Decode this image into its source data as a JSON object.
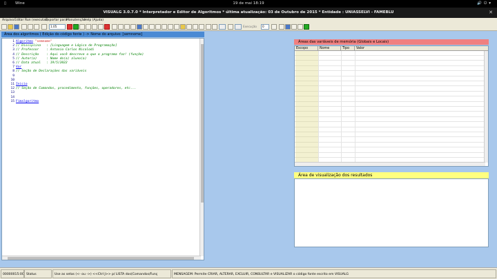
{
  "topbar": {
    "activities": "▯",
    "app_name": "Wine",
    "clock": "19 de mai   18:19",
    "tray": "🔊⏻▾"
  },
  "window": {
    "title": "VISUALG 3.0.7.0 * Interpretador e Editor de Algoritmos * última atualização: 03 de Outubro de 2015 * Entidade : UNIASSELVI - FAMEBLU",
    "close": "✕"
  },
  "menu": [
    "Arquivo",
    "Editar",
    "Run (executar)",
    "Exportar para",
    "Manutenção",
    "Help (Ajuda)"
  ],
  "toolbar": {
    "font_size": "1.05",
    "step_label": "Execução",
    "step_value": "0"
  },
  "code": {
    "header": "Área dos algoritmos ( Edição do código fonte ) -> Nome do arquivo: [semnome]",
    "lines": [
      {
        "n": "1",
        "kw": "Algoritmo",
        "str": " \"semnome\"",
        "cm": ""
      },
      {
        "n": "2",
        "kw": "",
        "str": "",
        "cm": "// Disciplina   : [Linguagem e Lógica de Programação]"
      },
      {
        "n": "3",
        "kw": "",
        "str": "",
        "cm": "// Professor    : Antonio Carlos Nicolodi"
      },
      {
        "n": "4",
        "kw": "",
        "str": "",
        "cm": "// Descrição    : Aqui você descreve o que o programa faz! (função)"
      },
      {
        "n": "5",
        "kw": "",
        "str": "",
        "cm": "// Autor(a)     : Nome do(a) aluno(a)"
      },
      {
        "n": "6",
        "kw": "",
        "str": "",
        "cm": "// Data atual   : 19/5/2022"
      },
      {
        "n": "7",
        "kw": "Var",
        "str": "",
        "cm": ""
      },
      {
        "n": "8",
        "kw": "",
        "str": "",
        "cm": "// Seção de Declarações das variáveis"
      },
      {
        "n": "9",
        "kw": "",
        "str": "",
        "cm": ""
      },
      {
        "n": "10",
        "kw": "",
        "str": "",
        "cm": ""
      },
      {
        "n": "11",
        "kw": "Inicio",
        "str": "",
        "cm": ""
      },
      {
        "n": "12",
        "kw": "",
        "str": "",
        "cm": "// Seção de Comandos, procedimento, funções, operadores, etc..."
      },
      {
        "n": "13",
        "kw": "",
        "str": "",
        "cm": ""
      },
      {
        "n": "14",
        "kw": "",
        "str": "",
        "cm": ""
      },
      {
        "n": "15",
        "kw": "Fimalgoritmo",
        "str": "",
        "cm": ""
      }
    ]
  },
  "memory": {
    "header": "Áreas das variáveis de memória (Globais e Locais)",
    "columns": [
      "Escopo",
      "Nome",
      "Tipo",
      "Valor"
    ]
  },
  "output": {
    "header": "Área de visualização dos resultados"
  },
  "status": {
    "position": "00000015:0002",
    "label": "Status",
    "hint": "Use as setas (<- ou ->) <<Ctrl J>> p/ LISTA dos(Comandos/Funç",
    "message": "MENSAGEM: Permite CRIAR, ALTERAR, EXCLUIR, CONSULTAR e VISUALIZAR o código fonte escrito em VISUALG"
  },
  "colors": {
    "code_header": "#4a8ad4",
    "memory_header": "#f08080",
    "output_header": "#ffff80",
    "client_bg": "#a8c8ec"
  }
}
